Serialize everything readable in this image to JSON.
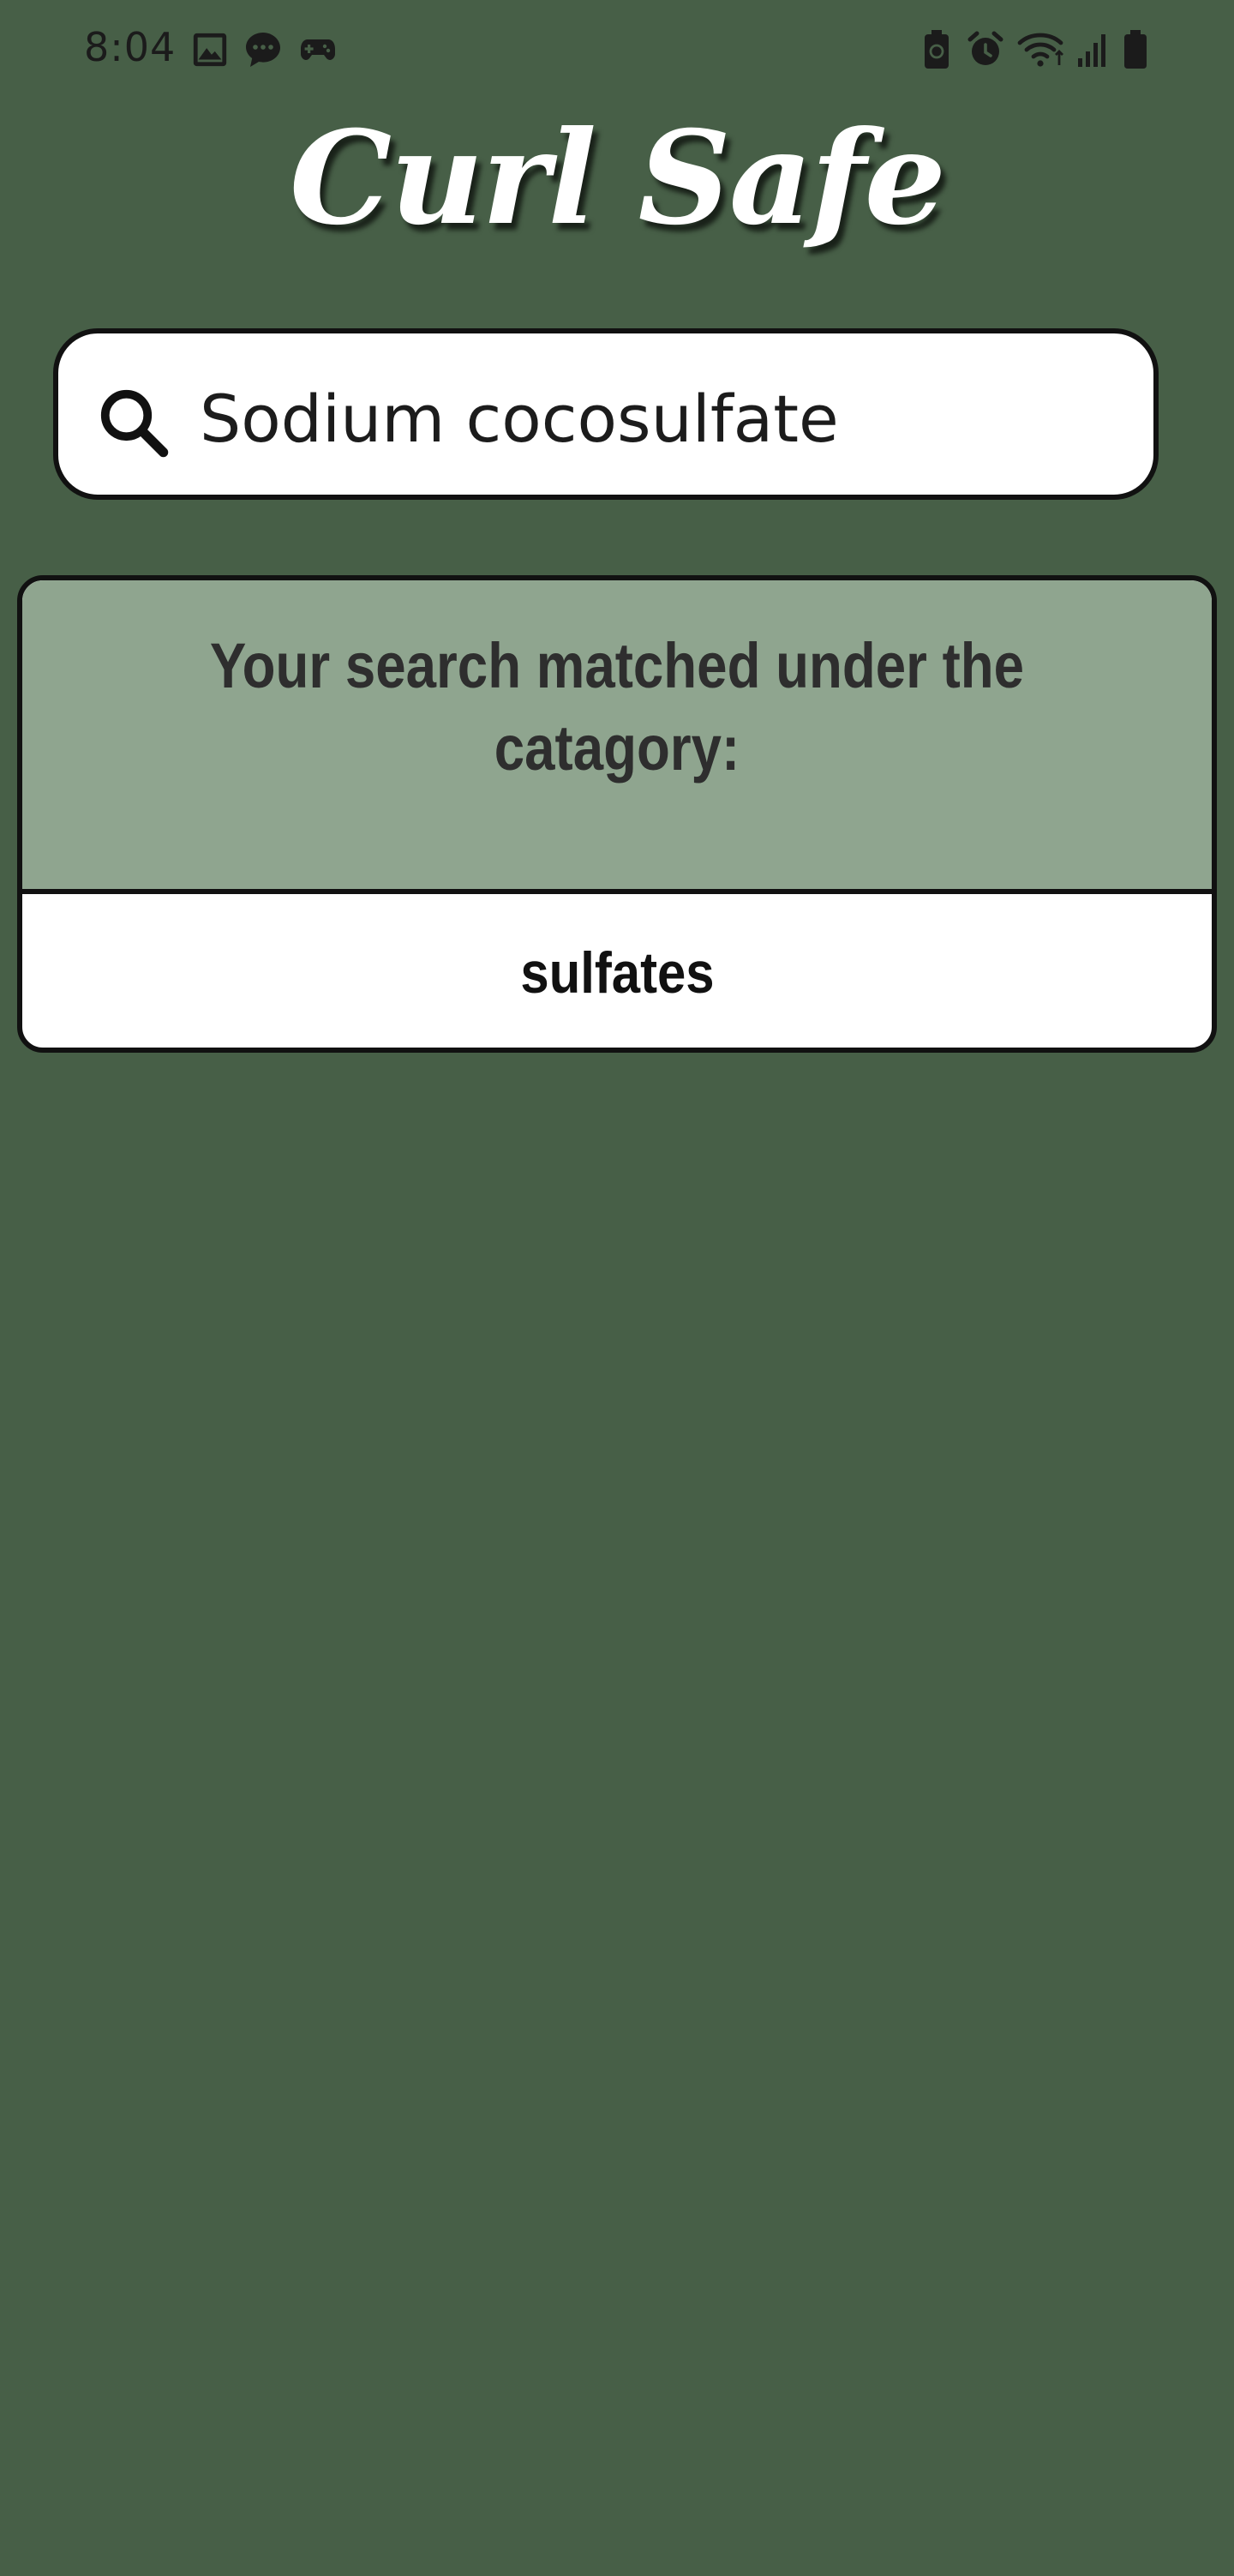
{
  "status_bar": {
    "time": "8:04",
    "left_icons": [
      "gallery-icon",
      "chat-icon",
      "game-controller-icon"
    ],
    "right_icons": [
      "battery-saver-icon",
      "alarm-icon",
      "wifi-icon",
      "signal-icon",
      "battery-icon"
    ]
  },
  "app": {
    "title": "Curl Safe"
  },
  "search": {
    "value": "Sodium cocosulfate",
    "icon": "search-icon"
  },
  "result": {
    "message": "Your search matched under the catagory:",
    "category": "sulfates"
  },
  "colors": {
    "background": "#475f47",
    "card_header": "#8fa58f",
    "card_body": "#ffffff",
    "border": "#111111",
    "title": "#ffffff"
  }
}
